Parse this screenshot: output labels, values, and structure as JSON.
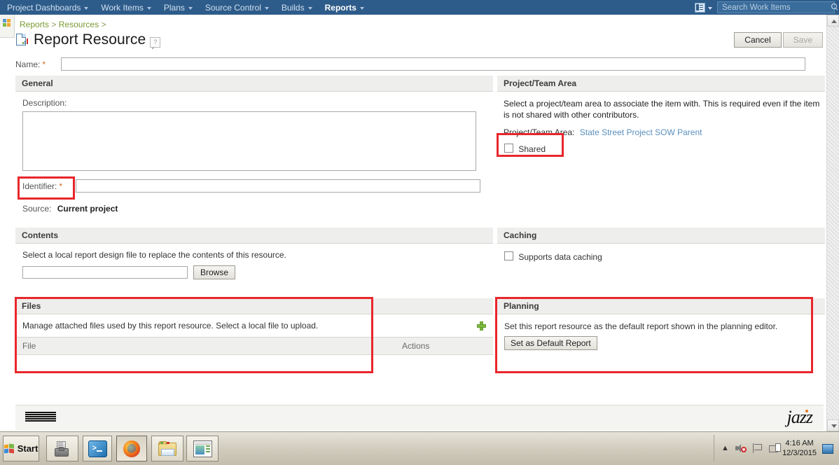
{
  "topnav": {
    "items": [
      {
        "label": "Project Dashboards",
        "has_caret": true,
        "active": false
      },
      {
        "label": "Work Items",
        "has_caret": true,
        "active": false
      },
      {
        "label": "Plans",
        "has_caret": true,
        "active": false
      },
      {
        "label": "Source Control",
        "has_caret": true,
        "active": false
      },
      {
        "label": "Builds",
        "has_caret": true,
        "active": false
      },
      {
        "label": "Reports",
        "has_caret": true,
        "active": true
      }
    ],
    "search_placeholder": "Search Work Items",
    "search_value": "",
    "accent_color": "#2e5c8a"
  },
  "breadcrumb": {
    "items": [
      "Reports",
      "Resources"
    ],
    "separator": ">",
    "trailing_separator": ">"
  },
  "header": {
    "title": "Report Resource",
    "help_glyph": "?",
    "cancel_label": "Cancel",
    "save_label": "Save"
  },
  "name_field": {
    "label": "Name:",
    "required_marker": "*",
    "value": "",
    "placeholder": ""
  },
  "general": {
    "heading": "General",
    "description_label": "Description:",
    "description_value": "",
    "identifier_label": "Identifier:",
    "identifier_required_marker": "*",
    "identifier_value": "",
    "source_label": "Source:",
    "source_value": "Current project"
  },
  "project_team_area": {
    "heading": "Project/Team Area",
    "intro": "Select a project/team area to associate the item with. This is required even if the item is not shared with other contributors.",
    "field_label": "Project/Team Area:",
    "field_value": "State Street Project SOW Parent",
    "shared_label": "Shared",
    "shared_checked": false
  },
  "contents": {
    "heading": "Contents",
    "intro": "Select a local report design file to replace the contents of this resource.",
    "file_value": "",
    "browse_label": "Browse"
  },
  "caching": {
    "heading": "Caching",
    "checkbox_label": "Supports data caching",
    "checked": false
  },
  "files": {
    "heading": "Files",
    "intro": "Manage attached files used by this report resource. Select a local file to upload.",
    "add_icon": "plus-icon",
    "columns": [
      "File",
      "Actions"
    ],
    "rows": []
  },
  "planning": {
    "heading": "Planning",
    "intro": "Set this report resource as the default report shown in the planning editor.",
    "button_label": "Set as Default Report"
  },
  "footer": {
    "ibm_logo": "ibm-logo",
    "jazz_logo": "jazz-logo"
  },
  "highlights": {
    "color": "#e8272c",
    "regions": [
      "identifier-label",
      "shared-checkbox",
      "files-section",
      "planning-section"
    ]
  },
  "taskbar": {
    "start_label": "Start",
    "buttons": [
      {
        "name": "start-button",
        "icon": "windows-logo-icon"
      },
      {
        "name": "taskbar-server-manager",
        "icon": "server-manager-icon"
      },
      {
        "name": "taskbar-powershell",
        "icon": "powershell-icon"
      },
      {
        "name": "taskbar-firefox",
        "icon": "firefox-icon"
      },
      {
        "name": "taskbar-explorer",
        "icon": "folder-icon"
      },
      {
        "name": "taskbar-app-window",
        "icon": "app-window-icon"
      }
    ],
    "tray_icons": [
      "chevron-up-icon",
      "volume-muted-icon",
      "flag-icon",
      "network-icon"
    ],
    "time": "4:16 AM",
    "date": "12/3/2015"
  }
}
